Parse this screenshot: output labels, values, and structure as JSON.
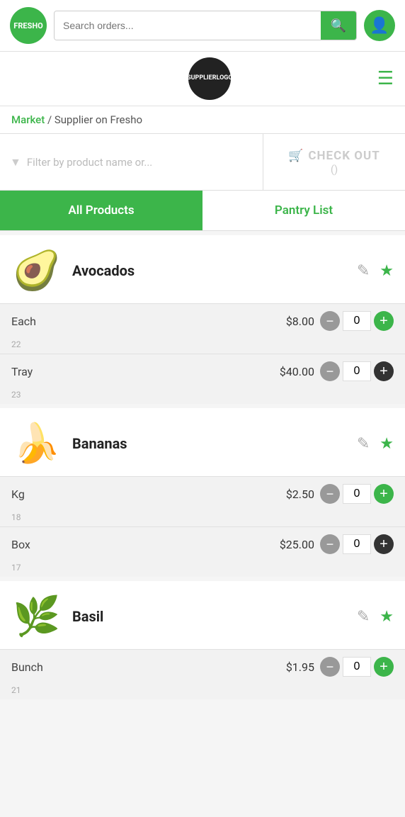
{
  "app": {
    "logo_text": "FRESHO",
    "search_placeholder": "Search orders...",
    "hamburger_symbol": "≡"
  },
  "supplier": {
    "logo_line1": "SUPPLIER",
    "logo_line2": "LOGO"
  },
  "breadcrumb": {
    "market_label": "Market",
    "separator": " / ",
    "page_label": "Supplier on Fresho"
  },
  "filter": {
    "placeholder": "Filter by product name or..."
  },
  "checkout": {
    "label": "CHECK OUT",
    "count": "()",
    "cart_icon": "🛒"
  },
  "tabs": {
    "all_products": "All Products",
    "pantry_list": "Pantry List"
  },
  "products": [
    {
      "id": "avocados",
      "name": "Avocados",
      "emoji": "🥑",
      "variants": [
        {
          "label": "Each",
          "price": "$8.00",
          "qty": "0",
          "id": "22"
        },
        {
          "label": "Tray",
          "price": "$40.00",
          "qty": "0",
          "id": "23"
        }
      ]
    },
    {
      "id": "bananas",
      "name": "Bananas",
      "emoji": "🍌",
      "variants": [
        {
          "label": "Kg",
          "price": "$2.50",
          "qty": "0",
          "id": "18"
        },
        {
          "label": "Box",
          "price": "$25.00",
          "qty": "0",
          "id": "17"
        }
      ]
    },
    {
      "id": "basil",
      "name": "Basil",
      "emoji": "🌿",
      "variants": [
        {
          "label": "Bunch",
          "price": "$1.95",
          "qty": "0",
          "id": "21"
        }
      ]
    }
  ],
  "icons": {
    "search": "🔍",
    "user": "👤",
    "edit": "✏️",
    "star_outline": "☆",
    "cart": "🛒",
    "filter": "▼"
  }
}
